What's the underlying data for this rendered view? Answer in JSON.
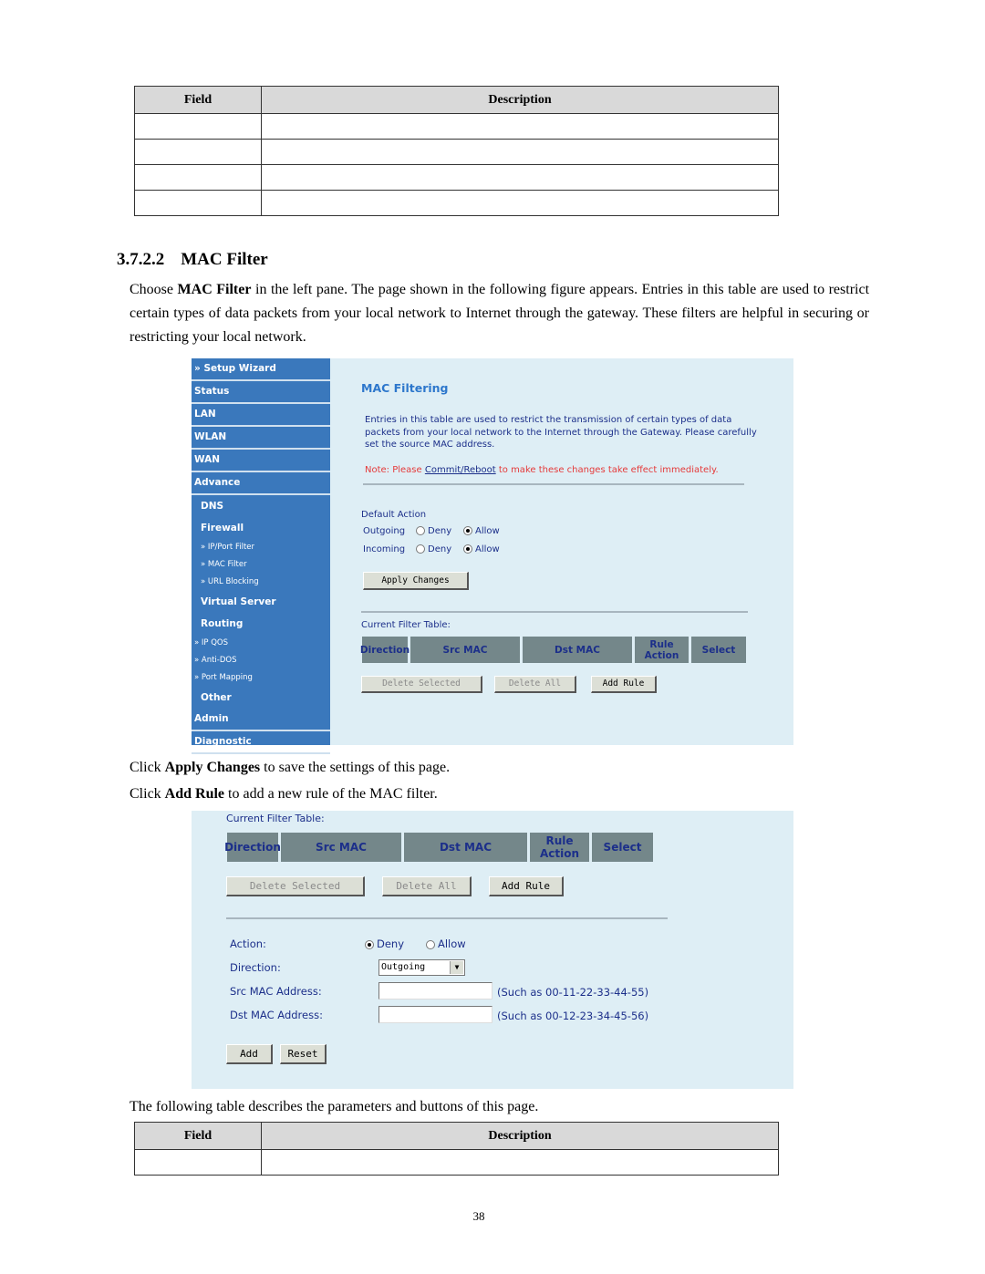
{
  "top_table": {
    "headers": [
      "Field",
      "Description"
    ],
    "rows": [
      [
        "",
        ""
      ],
      [
        "",
        ""
      ],
      [
        "",
        ""
      ],
      [
        "",
        ""
      ]
    ]
  },
  "section": {
    "number": "3.7.2.2",
    "title": "MAC Filter"
  },
  "intro": {
    "prefix": "Choose ",
    "bold": "MAC Filter",
    "rest": " in the left pane. The page shown in the following figure appears. Entries in this table are used to restrict certain types of data packets from your local network to Internet through the gateway. These filters are helpful in securing or restricting your local network."
  },
  "screenshot1": {
    "sidebar": [
      {
        "label": "» Setup Wizard",
        "type": "item"
      },
      {
        "label": "Status",
        "type": "item"
      },
      {
        "label": "LAN",
        "type": "item"
      },
      {
        "label": "WLAN",
        "type": "item"
      },
      {
        "label": "WAN",
        "type": "item"
      },
      {
        "label": "Advance",
        "type": "item"
      },
      {
        "label": "DNS",
        "type": "sub"
      },
      {
        "label": "Firewall",
        "type": "sub"
      },
      {
        "label": "» IP/Port Filter",
        "type": "sub2"
      },
      {
        "label": "» MAC Filter",
        "type": "sub2"
      },
      {
        "label": "» URL Blocking",
        "type": "sub2"
      },
      {
        "label": "Virtual Server",
        "type": "sub"
      },
      {
        "label": "Routing",
        "type": "sub"
      },
      {
        "label": "» IP QOS",
        "type": "sub3"
      },
      {
        "label": "» Anti-DOS",
        "type": "sub3"
      },
      {
        "label": "» Port Mapping",
        "type": "sub3"
      },
      {
        "label": "Other",
        "type": "sub"
      },
      {
        "label": "Admin",
        "type": "item"
      },
      {
        "label": "Diagnostic",
        "type": "item"
      }
    ],
    "title": "MAC Filtering",
    "description": "Entries in this table are used to restrict the transmission of certain types of data packets from your local network to the Internet through the Gateway. Please carefully set the source MAC address.",
    "note_prefix": "Note: Please ",
    "note_link": "Commit/Reboot",
    "note_suffix": " to make these changes take effect immediately.",
    "default_action_label": "Default Action",
    "outgoing_label": "Outgoing",
    "incoming_label": "Incoming",
    "deny_label": "Deny",
    "allow_label": "Allow",
    "outgoing_value": "Allow",
    "incoming_value": "Allow",
    "apply_button": "Apply Changes",
    "filter_table_label": "Current Filter Table:",
    "filter_headers": [
      "Direction",
      "Src MAC",
      "Dst MAC",
      "Rule Action",
      "Select"
    ],
    "delete_selected_button": "Delete Selected",
    "delete_all_button": "Delete All",
    "add_rule_button": "Add Rule"
  },
  "instructions": [
    {
      "prefix": "Click ",
      "bold": "Apply Changes",
      "rest": " to save the settings of this page."
    },
    {
      "prefix": "Click ",
      "bold": "Add Rule",
      "rest": " to add a new rule of the MAC filter."
    }
  ],
  "screenshot2": {
    "filter_table_label": "Current Filter Table:",
    "filter_headers": [
      "Direction",
      "Src MAC",
      "Dst MAC",
      "Rule Action",
      "Select"
    ],
    "delete_selected_button": "Delete Selected",
    "delete_all_button": "Delete All",
    "add_rule_button": "Add Rule",
    "action_label": "Action:",
    "deny_label": "Deny",
    "allow_label": "Allow",
    "action_value": "Deny",
    "direction_label": "Direction:",
    "direction_value": "Outgoing",
    "src_mac_label": "Src MAC Address:",
    "src_mac_value": "",
    "src_mac_hint": "(Such as 00-11-22-33-44-55)",
    "dst_mac_label": "Dst MAC Address:",
    "dst_mac_value": "",
    "dst_mac_hint": "(Such as 00-12-23-34-45-56)",
    "add_button": "Add",
    "reset_button": "Reset"
  },
  "following_text": "The following table describes the parameters and buttons of this page.",
  "bottom_table": {
    "headers": [
      "Field",
      "Description"
    ],
    "rows": [
      [
        "",
        ""
      ]
    ]
  },
  "page_number": "38"
}
